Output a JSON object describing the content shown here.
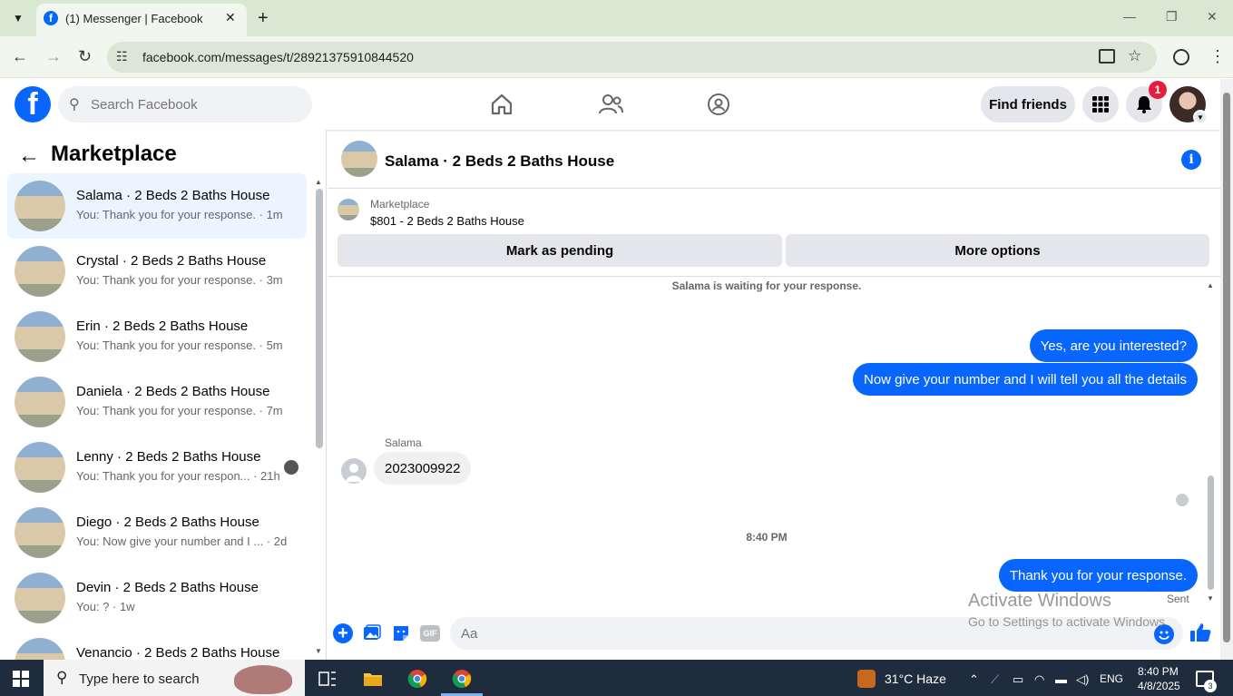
{
  "browser": {
    "tab_title": "(1) Messenger | Facebook",
    "url": "facebook.com/messages/t/28921375910844520"
  },
  "fb": {
    "search_placeholder": "Search Facebook",
    "find_friends": "Find friends",
    "notification_count": "1"
  },
  "sidebar": {
    "title": "Marketplace",
    "conversations": [
      {
        "name": "Salama · 2 Beds 2 Baths House",
        "preview": "You: Thank you for your response. · 1m",
        "active": true
      },
      {
        "name": "Crystal · 2 Beds 2 Baths House",
        "preview": "You: Thank you for your response. · 3m"
      },
      {
        "name": "Erin · 2 Beds 2 Baths House",
        "preview": "You: Thank you for your response. · 5m"
      },
      {
        "name": "Daniela · 2 Beds 2 Baths House",
        "preview": "You: Thank you for your response. · 7m"
      },
      {
        "name": "Lenny · 2 Beds 2 Baths House",
        "preview": "You: Thank you for your respon... · 21h"
      },
      {
        "name": "Diego · 2 Beds 2 Baths House",
        "preview": "You: Now give your number and I ... · 2d"
      },
      {
        "name": "Devin · 2 Beds 2 Baths House",
        "preview": "You: ? · 1w"
      },
      {
        "name": "Venancio · 2 Beds 2 Baths House",
        "preview": ""
      }
    ]
  },
  "chat": {
    "title": "Salama · 2 Beds 2 Baths House",
    "listing_label": "Marketplace",
    "listing_price": "$801 - 2 Beds 2 Baths House",
    "mark_pending": "Mark as pending",
    "more_options": "More options",
    "waiting": "Salama is waiting for your response.",
    "msg1": "Yes, are you interested?",
    "msg2": "Now give your number and I will tell you all the details",
    "sender": "Salama",
    "msg3": "2023009922",
    "time": "8:40 PM",
    "msg4": "Thank you for your response.",
    "status": "Sent",
    "input_placeholder": "Aa",
    "gif": "GIF"
  },
  "watermark": {
    "title": "Activate Windows",
    "subtitle": "Go to Settings to activate Windows."
  },
  "taskbar": {
    "search_text": "Type here to search",
    "weather": "31°C  Haze",
    "lang": "ENG",
    "time": "8:40 PM",
    "date": "4/8/2025",
    "notif_count": "3"
  }
}
